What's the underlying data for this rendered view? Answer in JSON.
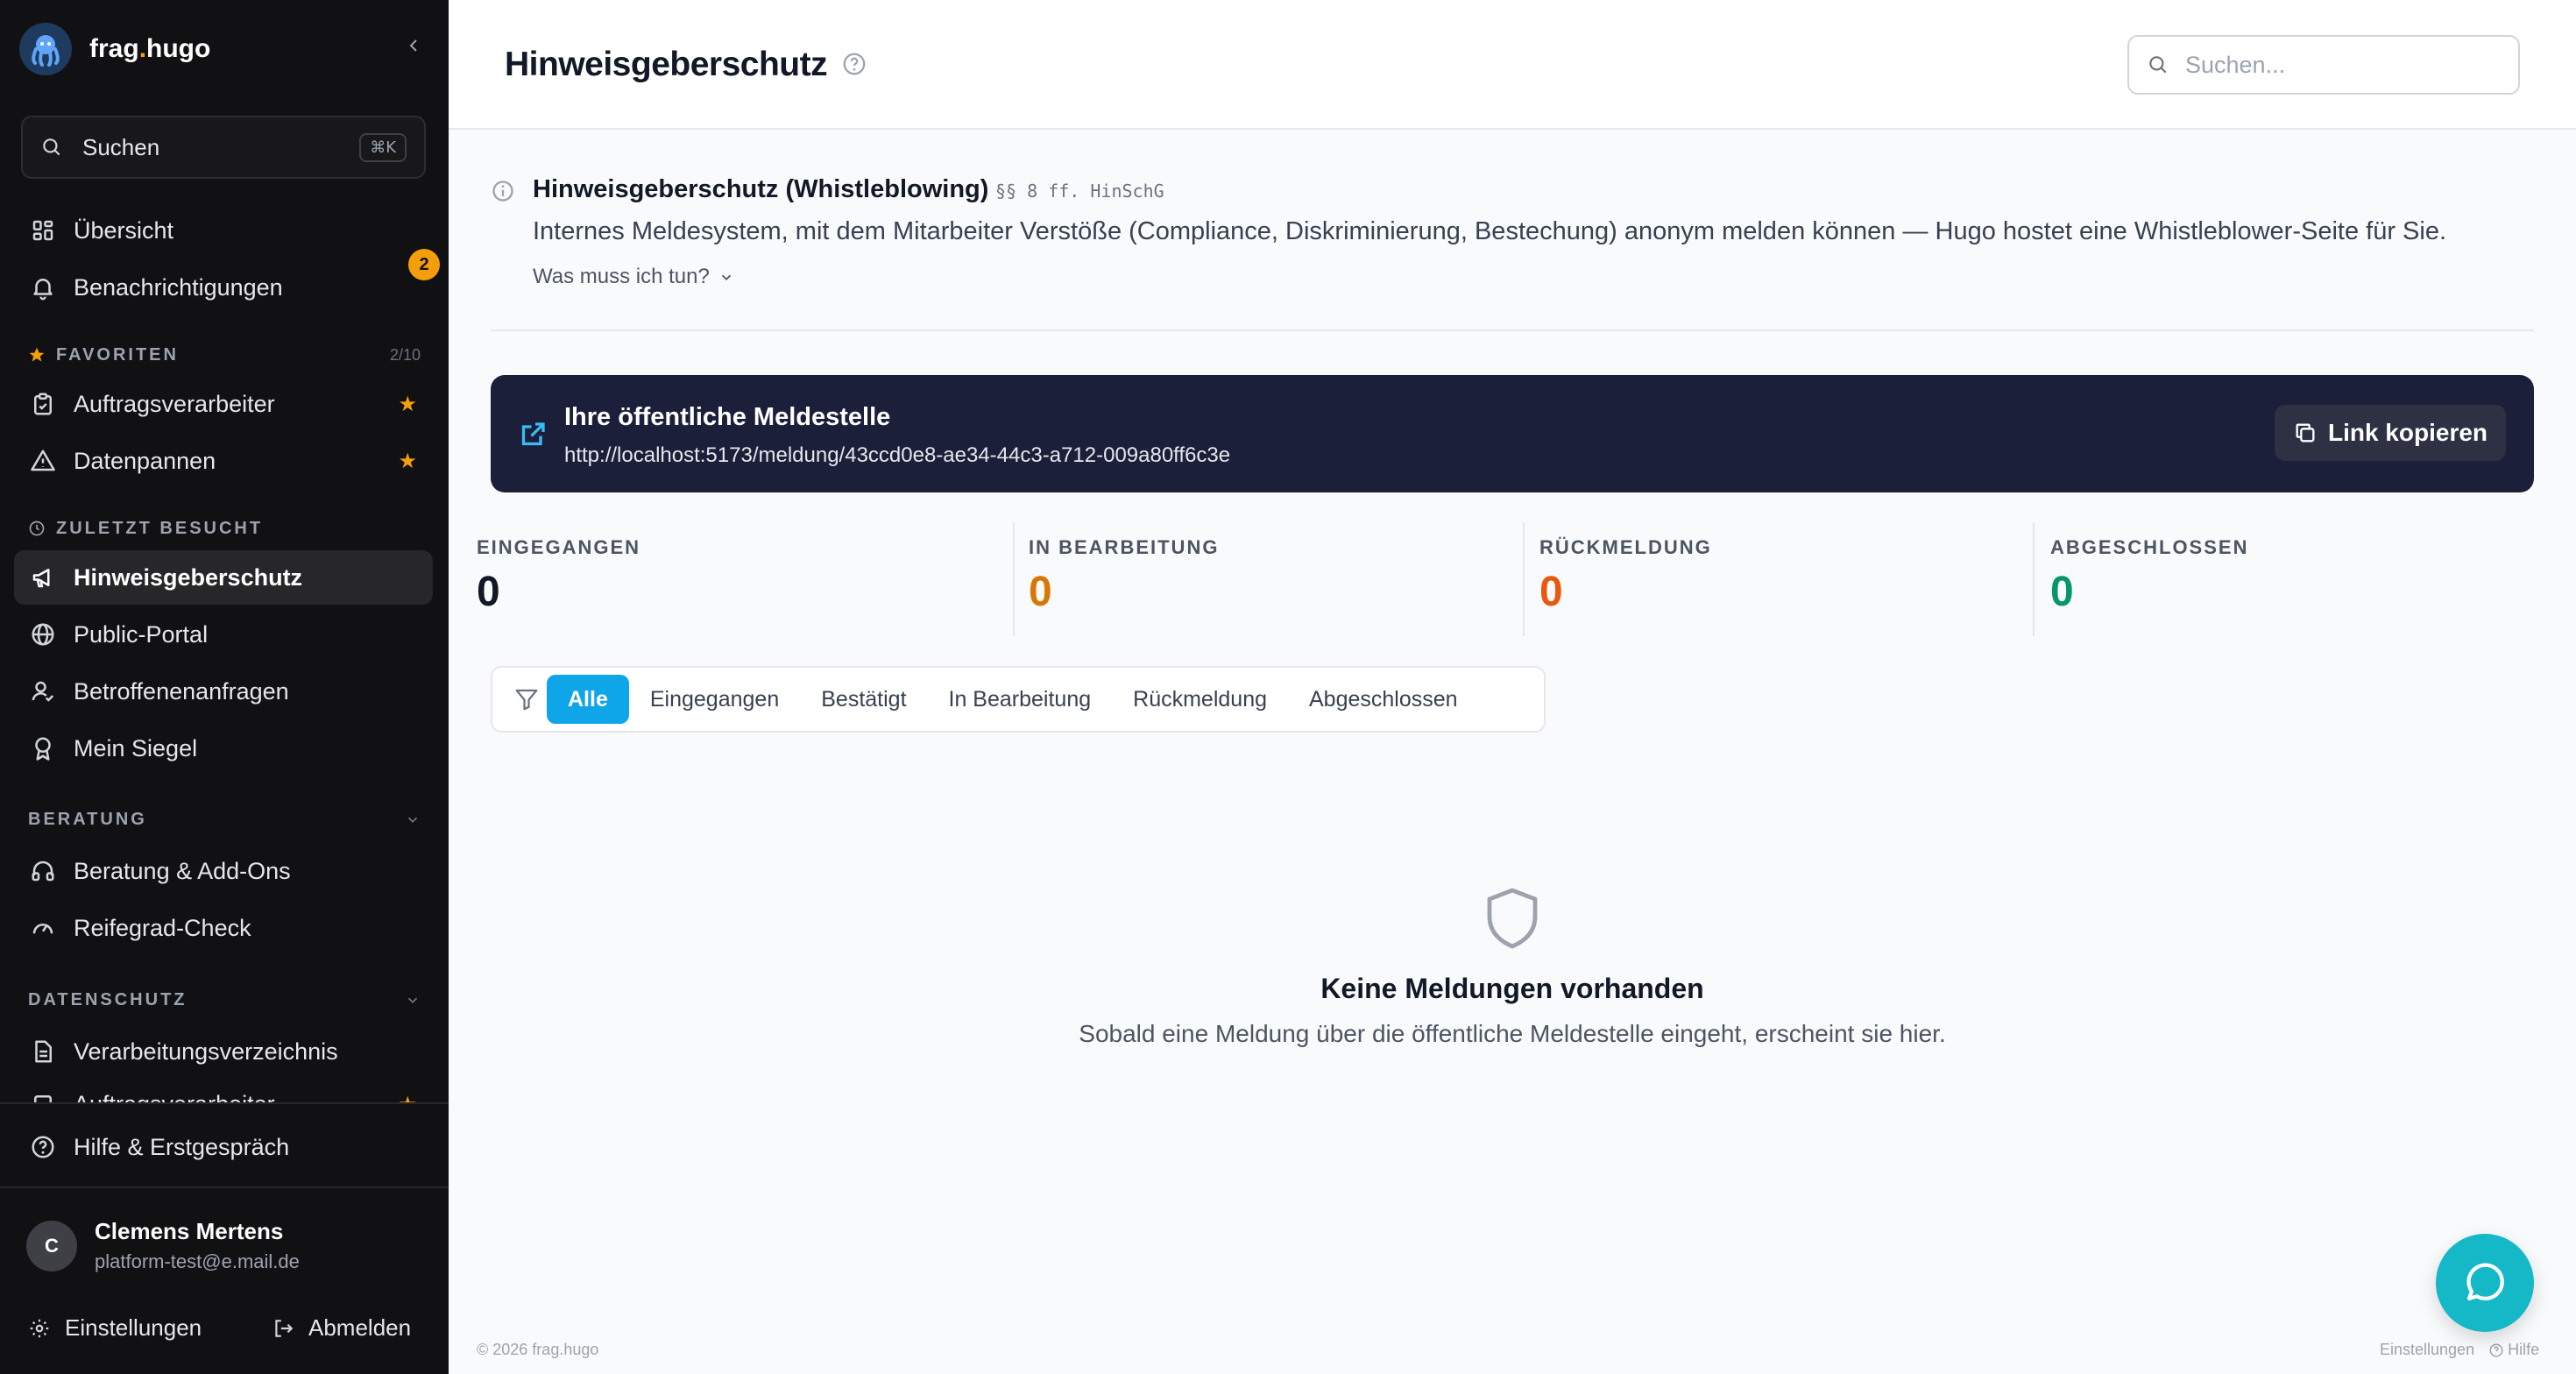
{
  "brand": {
    "name_prefix": "frag",
    "name_dot": ".",
    "name_suffix": "hugo"
  },
  "sidebar": {
    "search_label": "Suchen",
    "search_shortcut": "⌘K",
    "main_items": [
      {
        "label": "Übersicht",
        "icon": "grid-icon"
      },
      {
        "label": "Benachrichtigungen",
        "icon": "bell-icon",
        "badge": "2"
      }
    ],
    "favorites": {
      "title": "FAVORITEN",
      "count": "2/10",
      "items": [
        {
          "label": "Auftragsverarbeiter",
          "icon": "clipboard-icon"
        },
        {
          "label": "Datenpannen",
          "icon": "warning-icon"
        }
      ]
    },
    "recent": {
      "title": "ZULETZT BESUCHT",
      "items": [
        {
          "label": "Hinweisgeberschutz",
          "icon": "megaphone-icon",
          "active": true
        },
        {
          "label": "Public-Portal",
          "icon": "globe-icon"
        },
        {
          "label": "Betroffenenanfragen",
          "icon": "user-check-icon"
        },
        {
          "label": "Mein Siegel",
          "icon": "award-icon"
        }
      ]
    },
    "beratung": {
      "title": "BERATUNG",
      "items": [
        {
          "label": "Beratung & Add-Ons",
          "icon": "headphones-icon"
        },
        {
          "label": "Reifegrad-Check",
          "icon": "gauge-icon"
        }
      ]
    },
    "datenschutz": {
      "title": "DATENSCHUTZ",
      "items": [
        {
          "label": "Verarbeitungsverzeichnis",
          "icon": "file-text-icon"
        },
        {
          "label": "Auftragsverarbeiter",
          "icon": "clipboard-icon"
        }
      ]
    },
    "help_label": "Hilfe & Erstgespräch",
    "user": {
      "initial": "C",
      "name": "Clemens Mertens",
      "email": "platform-test@e.mail.de"
    },
    "settings_label": "Einstellungen",
    "logout_label": "Abmelden"
  },
  "header": {
    "title": "Hinweisgeberschutz",
    "search_placeholder": "Suchen..."
  },
  "info": {
    "title": "Hinweisgeberschutz (Whistleblowing)",
    "law": "§§ 8 ff. HinSchG",
    "description": "Internes Meldesystem, mit dem Mitarbeiter Verstöße (Compliance, Diskriminierung, Bestechung) anonym melden können — Hugo hostet eine Whistleblower-Seite für Sie.",
    "toggle": "Was muss ich tun?"
  },
  "banner": {
    "title": "Ihre öffentliche Meldestelle",
    "url": "http://localhost:5173/meldung/43ccd0e8-ae34-44c3-a712-009a80ff6c3e",
    "copy_label": "Link kopieren"
  },
  "stats": [
    {
      "label": "EINGEGANGEN",
      "value": "0",
      "color": "#111827"
    },
    {
      "label": "IN BEARBEITUNG",
      "value": "0",
      "color": "#d97706"
    },
    {
      "label": "RÜCKMELDUNG",
      "value": "0",
      "color": "#ea580c"
    },
    {
      "label": "ABGESCHLOSSEN",
      "value": "0",
      "color": "#059669"
    }
  ],
  "filters": [
    "Alle",
    "Eingegangen",
    "Bestätigt",
    "In Bearbeitung",
    "Rückmeldung",
    "Abgeschlossen"
  ],
  "empty": {
    "title": "Keine Meldungen vorhanden",
    "subtitle": "Sobald eine Meldung über die öffentliche Meldestelle eingeht, erscheint sie hier."
  },
  "footer": {
    "copyright": "© 2026 frag.hugo",
    "settings": "Einstellungen",
    "help": "Hilfe"
  },
  "colors": {
    "accent": "#0ea5e9",
    "sidebar_bg": "#111113",
    "banner_bg": "#1b1f3a",
    "chat": "#14b8c6",
    "star": "#f59e0b"
  }
}
